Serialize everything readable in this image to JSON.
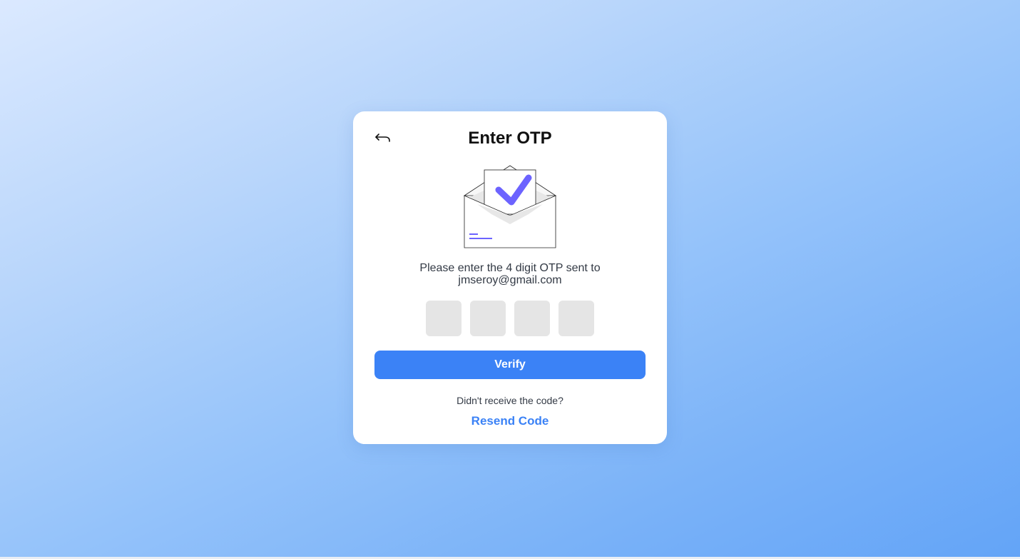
{
  "otp_card": {
    "title": "Enter OTP",
    "back_icon": "back-arrow-icon",
    "illustration_icon": "envelope-check-icon",
    "message_line1": "Please enter the 4 digit OTP sent to",
    "email": "jmseroy@gmail.com",
    "otp_digits": [
      "",
      "",
      "",
      ""
    ],
    "verify_label": "Verify",
    "resend_prompt": "Didn't receive the code?",
    "resend_label": "Resend Code"
  },
  "colors": {
    "accent": "#3b82f6",
    "check_purple": "#6c63ff",
    "otp_box_bg": "#e5e5e5",
    "card_bg": "#ffffff"
  }
}
